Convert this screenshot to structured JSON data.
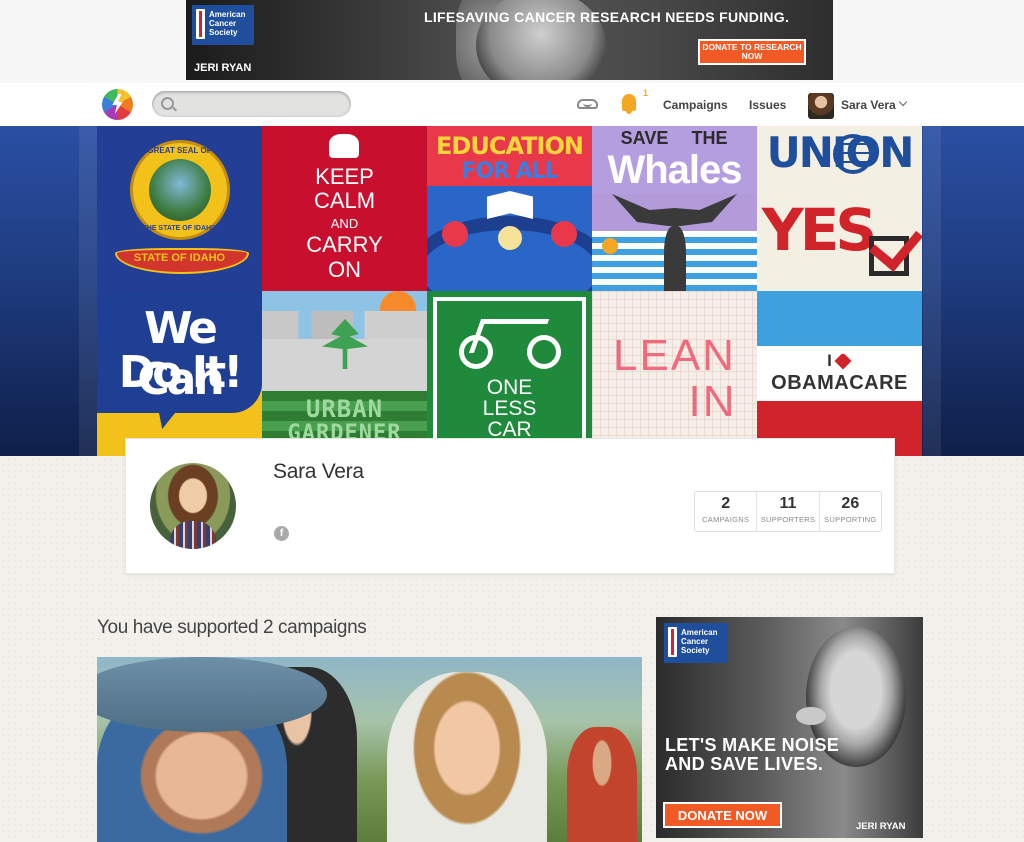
{
  "top_ad": {
    "brand": "American Cancer Society",
    "headline": "LIFESAVING CANCER RESEARCH NEEDS FUNDING.",
    "cta": "DONATE TO RESEARCH NOW",
    "celebrity": "JERI RYAN",
    "accent": "#f15a24"
  },
  "nav": {
    "search_placeholder": "",
    "notification_count": "1",
    "campaigns": "Campaigns",
    "issues": "Issues",
    "user_name": "Sara Vera",
    "icons": [
      "logo-bolt-icon",
      "search-icon",
      "inbox-icon",
      "bell-icon",
      "chevron-down-icon"
    ]
  },
  "hero_tiles": [
    {
      "name": "idaho-seal",
      "line1": "GREAT SEAL OF",
      "line2": "THE STATE OF IDAHO",
      "banner": "STATE OF IDAHO"
    },
    {
      "name": "keep-calm",
      "line1": "KEEP",
      "line2": "CALM",
      "line3": "AND",
      "line4": "CARRY",
      "line5": "ON"
    },
    {
      "name": "education",
      "line1": "EDUCATION",
      "line2": "FOR ALL"
    },
    {
      "name": "save-whales",
      "line1": "SAVE",
      "line2": "THE",
      "line3": "Whales"
    },
    {
      "name": "union-yes",
      "line1": "UNION",
      "line2": "YES"
    },
    {
      "name": "we-can",
      "line1": "We Can",
      "line2": "Do It!"
    },
    {
      "name": "urban-gardener",
      "line1": "URBAN",
      "line2": "GARDENER"
    },
    {
      "name": "one-less-car",
      "line1": "ONE",
      "line2": "LESS",
      "line3": "CAR"
    },
    {
      "name": "lean-in",
      "line1": "LEAN",
      "line2": "IN"
    },
    {
      "name": "obamacare",
      "line1": "I",
      "line2": "OBAMACARE"
    }
  ],
  "profile": {
    "name": "Sara Vera",
    "social": "f",
    "stats": [
      {
        "value": "2",
        "label": "CAMPAIGNS"
      },
      {
        "value": "11",
        "label": "SUPPORTERS"
      },
      {
        "value": "26",
        "label": "SUPPORTING"
      }
    ]
  },
  "supported": {
    "title": "You have supported 2 campaigns"
  },
  "side_ad": {
    "brand": "American Cancer Society",
    "headline_1": "LET'S MAKE NOISE",
    "headline_2": "AND SAVE LIVES.",
    "cta": "DONATE NOW",
    "celebrity": "JERI RYAN"
  }
}
